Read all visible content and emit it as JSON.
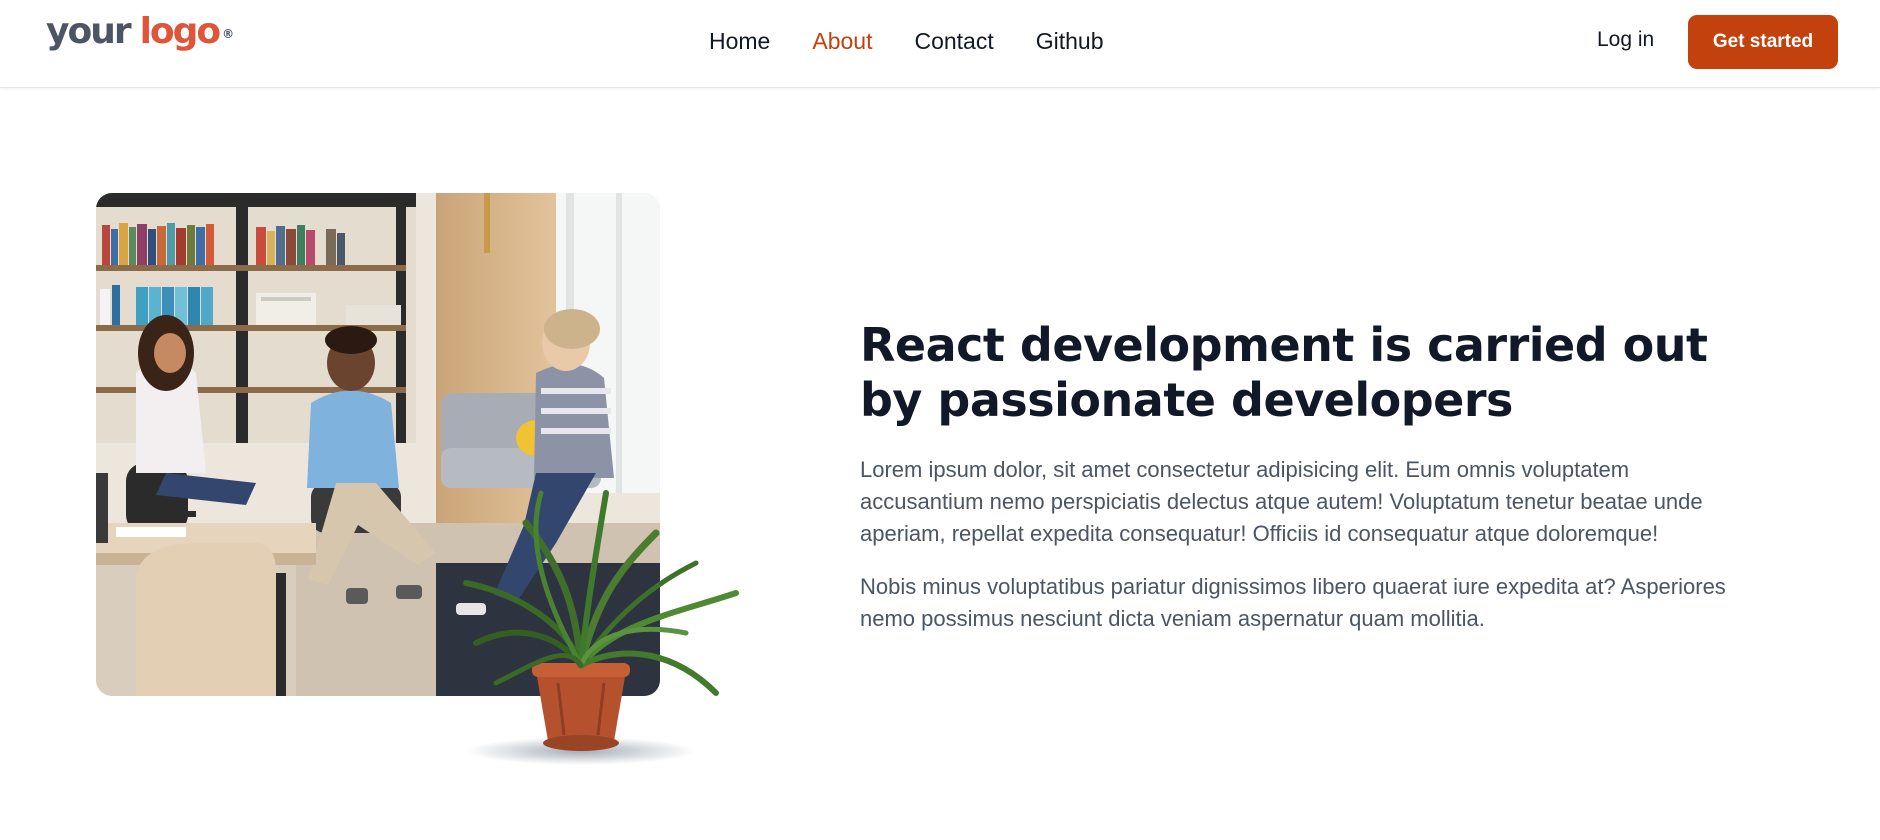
{
  "header": {
    "logo": {
      "word1": "your",
      "word2": "logo",
      "mark": "®"
    },
    "nav": [
      {
        "label": "Home",
        "active": false
      },
      {
        "label": "About",
        "active": true
      },
      {
        "label": "Contact",
        "active": false
      },
      {
        "label": "Github",
        "active": false
      }
    ],
    "login_label": "Log in",
    "cta_label": "Get started"
  },
  "hero": {
    "headline": "React development is carried out by passionate developers",
    "paragraphs": [
      "Lorem ipsum dolor, sit amet consectetur adipisicing elit. Eum omnis voluptatem accusantium nemo perspiciatis delectus atque autem! Voluptatum tenetur beatae unde aperiam, repellat expedita consequatur! Officiis id consequatur atque doloremque!",
      "Nobis minus voluptatibus pariatur dignissimos libero quaerat iure expedita at? Asperiores nemo possimus nesciunt dicta veniam aspernatur quam mollitia."
    ]
  },
  "colors": {
    "accent": "#c2410c",
    "logo_accent": "#e0553a",
    "heading": "#111827",
    "body_text": "#4b5563"
  }
}
